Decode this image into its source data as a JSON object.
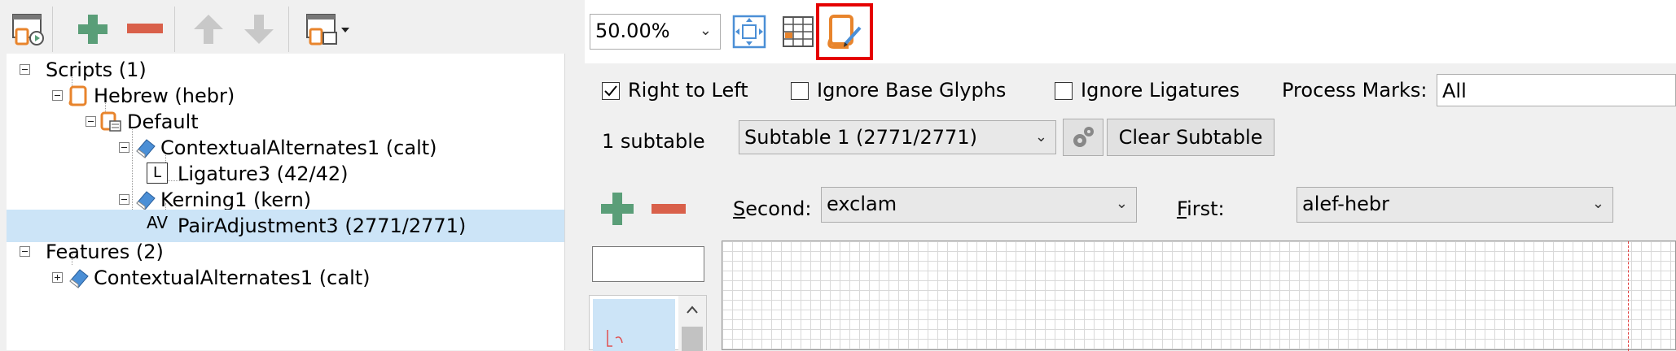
{
  "left_toolbar": {
    "buttons": [
      {
        "icon": "feature-preview-icon"
      },
      {
        "icon": "add-icon"
      },
      {
        "icon": "remove-icon"
      },
      {
        "icon": "move-up-icon"
      },
      {
        "icon": "move-down-icon"
      },
      {
        "icon": "apply-dropdown-icon"
      }
    ]
  },
  "tree": {
    "items": [
      {
        "label": "Scripts (1)"
      },
      {
        "label": "Hebrew (hebr)"
      },
      {
        "label": "Default"
      },
      {
        "label": "ContextualAlternates1 (calt)"
      },
      {
        "label": "Ligature3 (42/42)",
        "glyph": "L"
      },
      {
        "label": "Kerning1 (kern)"
      },
      {
        "label": "PairAdjustment3 (2771/2771)",
        "glyph": "AV"
      },
      {
        "label": "Features (2)"
      },
      {
        "label": "ContextualAlternates1 (calt)"
      }
    ]
  },
  "right_toolbar": {
    "zoom": "50.00%"
  },
  "options": {
    "right_to_left": "Right to Left",
    "ignore_base_glyphs": "Ignore Base Glyphs",
    "ignore_ligatures": "Ignore Ligatures",
    "process_marks_label": "Process Marks:",
    "process_marks_value": "All"
  },
  "subtable": {
    "count": "1 subtable",
    "selected": "Subtable 1 (2771/2771)",
    "clear": "Clear Subtable"
  },
  "pair": {
    "second_label_u": "S",
    "second_label_rest": "econd:",
    "second_value": "exclam",
    "first_label_u": "F",
    "first_label_rest": "irst:",
    "first_value": "alef-hebr"
  },
  "colors": {
    "accent_orange": "#e8842c",
    "add_green": "#5a9e78",
    "remove_red": "#d9604a",
    "highlight_red": "#e50000",
    "selection": "#cce4f7"
  }
}
